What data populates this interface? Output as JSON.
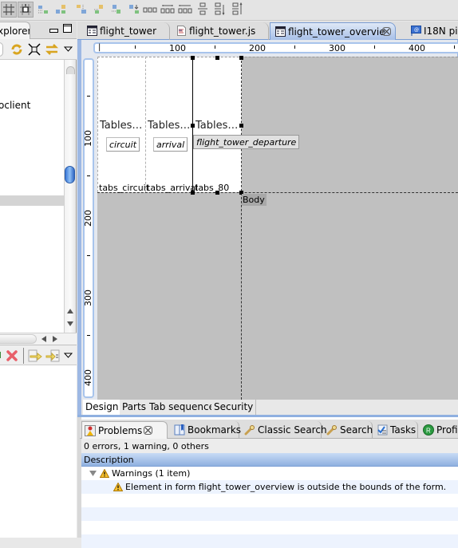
{
  "toolbar": {
    "buttons": [
      {
        "icon": "grid-icon",
        "active": true
      },
      {
        "icon": "snap-to-grid-icon",
        "active": true
      },
      {
        "icon": "align-left-icon"
      },
      {
        "icon": "align-center-icon"
      },
      {
        "icon": "align-right-icon"
      },
      {
        "icon": "align-top-icon"
      },
      {
        "icon": "align-middle-icon"
      },
      {
        "icon": "align-bottom-icon"
      },
      {
        "icon": "space-horizontal-icon"
      },
      {
        "icon": "distribute-horizontal-icon"
      },
      {
        "icon": "compact-horizontal-icon"
      },
      {
        "icon": "space-vertical-icon"
      },
      {
        "icon": "distribute-vertical-icon"
      },
      {
        "icon": "compact-vertical-icon"
      }
    ]
  },
  "left_view": {
    "tab_label": "Explorer",
    "tab_label_visible": "xplorer",
    "minimize_icon": "minimize-icon",
    "maximize_icon": "maximize-icon",
    "tree_item": "client",
    "tree_item_visible": "oclient"
  },
  "editor": {
    "tabs": [
      {
        "label": "flight_tower",
        "icon": "form-icon",
        "active": false
      },
      {
        "label": "flight_tower.js",
        "icon": "js-file-icon",
        "active": false
      },
      {
        "label": "flight_tower_overvie",
        "icon": "form-icon",
        "active": true,
        "closable": true
      },
      {
        "label": "I18N pi",
        "icon": "i18n-icon",
        "active": false
      }
    ],
    "hruler_labels": [
      "100",
      "200",
      "300",
      "400"
    ],
    "vruler_labels": [
      "100",
      "200",
      "300",
      "400"
    ],
    "form": {
      "columns": [
        {
          "title": "Tables…",
          "button": "circuit",
          "label": "tabs_circuit"
        },
        {
          "title": "Tables…",
          "button": "arrival",
          "label": "tabs_arrival"
        },
        {
          "title": "Tables…",
          "button": "flight_tower_departure",
          "label": "tabs_80"
        }
      ],
      "body_label": "Body"
    },
    "bottom_tabs": [
      "Design",
      "Parts",
      "Tab sequence",
      "Security"
    ],
    "active_bottom_tab": "Design"
  },
  "problems": {
    "tabs": [
      {
        "label": "Problems",
        "icon": "problems-icon",
        "active": true,
        "closable": true
      },
      {
        "label": "Bookmarks",
        "icon": "bookmarks-icon"
      },
      {
        "label": "Classic Search",
        "icon": "search-icon"
      },
      {
        "label": "Search",
        "icon": "search-icon"
      },
      {
        "label": "Tasks",
        "icon": "tasks-icon"
      },
      {
        "label": "Profil",
        "icon": "profiler-icon"
      }
    ],
    "summary": "0 errors, 1 warning, 0 others",
    "column_header": "Description",
    "groups": [
      {
        "label": "Warnings (1 item)",
        "items": [
          "Element in form flight_tower_overview is outside the bounds of the form."
        ]
      }
    ]
  },
  "colors": {
    "accent_blue": "#7b9ed4",
    "canvas_gray": "#c0c0c0",
    "warning_yellow": "#f0b400"
  }
}
